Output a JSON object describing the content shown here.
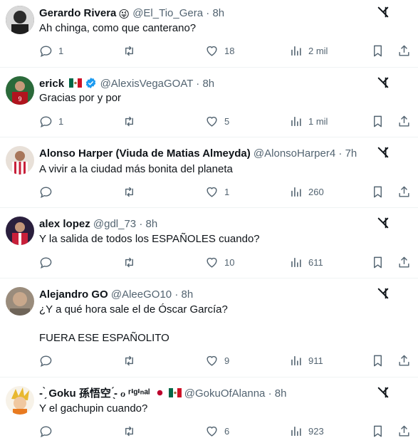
{
  "tweets": [
    {
      "name": "Gerardo Rivera",
      "handle": "@El_Tio_Gera",
      "dot": "·",
      "time": "8h",
      "text": "Ah chinga, como que canterano?",
      "replies": "1",
      "retweets": "",
      "likes": "18",
      "views": "2 mil",
      "emoji": "😜",
      "avatar_color": "#444444"
    },
    {
      "name": "erick",
      "handle": "@AlexisVegaGOAT",
      "dot": "·",
      "time": "8h",
      "text": "Gracias por y por",
      "replies": "1",
      "retweets": "",
      "likes": "5",
      "views": "1 mil",
      "flag": "mx",
      "verified": true,
      "avatar_color": "#b0141e"
    },
    {
      "name": "Alonso Harper (Viuda de Matias Almeyda)",
      "handle": "@AlonsoHarper4",
      "dot": "·",
      "time": "7h",
      "text": "A vivir a la ciudad más bonita del planeta",
      "replies": "",
      "retweets": "",
      "likes": "1",
      "views": "260",
      "avatar_color": "#c8203a"
    },
    {
      "name": "alex lopez",
      "handle": "@gdl_73",
      "dot": "·",
      "time": "8h",
      "text": "Y la salida de todos los ESPAÑOLES cuando?",
      "replies": "",
      "retweets": "",
      "likes": "10",
      "views": "611",
      "avatar_color": "#3a2a52"
    },
    {
      "name": "Alejandro GO",
      "handle": "@AleeGO10",
      "dot": "·",
      "time": "8h",
      "text": "¿Y a qué hora sale el de Óscar García?",
      "text2": "FUERA ESE ESPAÑOLITO",
      "replies": "",
      "retweets": "",
      "likes": "9",
      "views": "911",
      "avatar_color": "#8a7a6a"
    },
    {
      "name": "- ̗̀ Goku 孫悟空 ̖́- ℴ ʳⁱᵍⁱⁿᵃˡ",
      "handle": "@GokuOfAlanna",
      "dot": "·",
      "time": "8h",
      "text": "Y el gachupin cuando?",
      "replies": "",
      "retweets": "",
      "likes": "6",
      "views": "923",
      "flags": "jp-mx",
      "avatar_color": "#e8c87a"
    }
  ],
  "colors": {
    "text": "#0f1419",
    "muted": "#536471",
    "divider": "#eff3f4",
    "verified": "#1d9bf0"
  },
  "icons": [
    "reply-icon",
    "retweet-icon",
    "like-icon",
    "views-icon",
    "bookmark-icon",
    "share-icon",
    "grok-icon"
  ]
}
